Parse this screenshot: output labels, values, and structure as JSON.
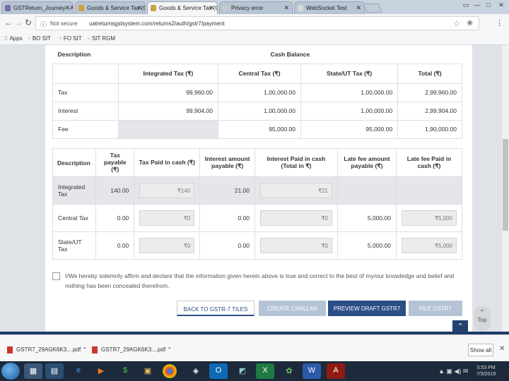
{
  "browser": {
    "tabs": [
      {
        "label": "GSTReturn_Journey - Ag",
        "favicon_color": "#7a6aa8",
        "active": false
      },
      {
        "label": "Goods & Service Tax (GS",
        "favicon_color": "#c9a441",
        "active": false
      },
      {
        "label": "Goods & Service Tax (GS",
        "favicon_color": "#c9a441",
        "active": true
      },
      {
        "label": "Privacy error",
        "favicon_color": "#c9c9c9",
        "active": false
      },
      {
        "label": "WebSocket Test",
        "favicon_color": "#d8d8d8",
        "active": false
      }
    ],
    "window_controls": [
      "▭",
      "—",
      "□",
      "✕"
    ],
    "security_label": "Not secure",
    "url": "uatreturnsgstsystem.com/returns2/auth/gstr7/payment",
    "bookmarks": [
      "Apps",
      "BO SIT",
      "FO SIT",
      "SIT RGM"
    ]
  },
  "cash_balance": {
    "description_header": "Description",
    "group_header": "Cash Balance",
    "columns": [
      "Integrated Tax (₹)",
      "Central Tax (₹)",
      "State/UT Tax (₹)",
      "Total (₹)"
    ],
    "rows": [
      {
        "label": "Tax",
        "values": [
          "99,960.00",
          "1,00,000.00",
          "1,00,000.00",
          "2,99,960.00"
        ]
      },
      {
        "label": "Interest",
        "values": [
          "99,904.00",
          "1,00,000.00",
          "1,00,000.00",
          "2,99,904.00"
        ]
      },
      {
        "label": "Fee",
        "values": [
          "",
          "95,000.00",
          "95,000.00",
          "1,90,000.00"
        ]
      }
    ]
  },
  "payment": {
    "columns": [
      "Description",
      "Tax payable (₹)",
      "Tax Paid in cash (₹)",
      "Interest amount payable (₹)",
      "Interest Paid in cash (Total in ₹)",
      "Late fee amount payable (₹)",
      "Late fee Paid in cash (₹)"
    ],
    "rows": [
      {
        "label": "Integrated Tax",
        "tax_payable": "140.00",
        "tax_paid": "₹140",
        "interest_payable": "21.00",
        "interest_paid": "₹21",
        "late_fee_payable": "",
        "late_fee_paid": ""
      },
      {
        "label": "Central Tax",
        "tax_payable": "0.00",
        "tax_paid": "₹0",
        "interest_payable": "0.00",
        "interest_paid": "₹0",
        "late_fee_payable": "5,000.00",
        "late_fee_paid": "₹5,000"
      },
      {
        "label": "State/UT Tax",
        "tax_payable": "0.00",
        "tax_paid": "₹0",
        "interest_payable": "0.00",
        "interest_paid": "₹0",
        "late_fee_payable": "5,000.00",
        "late_fee_paid": "₹5,000"
      }
    ]
  },
  "declaration": "I/We hereby solemnly affirm and declare that the information given herein above is true and correct to the best of my/our knowledge and belief and nothing has been concealed therefrom.",
  "buttons": {
    "back": "BACK TO GSTR-7 TILES",
    "challan": "CREATE CHALLAN",
    "preview": "PREVIEW DRAFT GSTR7",
    "file": "FILE GSTR7",
    "top": "Top"
  },
  "downloads": {
    "items": [
      "GSTR7_29AGK6K3....pdf",
      "GSTR7_29AGK6K3....pdf"
    ],
    "show_all": "Show all"
  },
  "taskbar": {
    "apps": [
      "ie",
      "media",
      "explorer",
      "chrome",
      "outlook",
      "excel",
      "word",
      "acrobat"
    ],
    "clock_time": "5:53 PM",
    "clock_date": "7/3/2019"
  }
}
